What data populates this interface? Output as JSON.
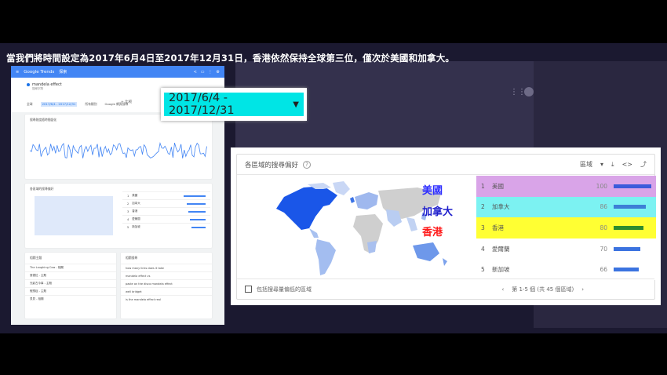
{
  "caption": "當我們將時間設定為2017年6月4日至2017年12月31日，香港依然保持全球第三位，僅次於美國和加拿大。",
  "trends": {
    "logo": "Google Trends",
    "section": "探索",
    "term": "mandela effect",
    "term_sub": "搜尋字詞",
    "add_label": "+ 比較",
    "filters": [
      "全球",
      "2017/6/4 - 2017/12/31",
      "所有類別",
      "Google 網頁搜尋"
    ],
    "card1_title": "搜尋熱度隨時間變化",
    "card2_title": "各區域的搜尋偏好",
    "card2_rows": [
      {
        "rank": "1",
        "name": "美國",
        "pct": 100
      },
      {
        "rank": "2",
        "name": "加拿大",
        "pct": 86
      },
      {
        "rank": "3",
        "name": "香港",
        "pct": 80
      },
      {
        "rank": "4",
        "name": "愛爾蘭",
        "pct": 70
      },
      {
        "rank": "5",
        "name": "新加坡",
        "pct": 66
      }
    ],
    "card3_title": "相關主題",
    "card4_title": "相關搜尋",
    "card3_rows": [
      "The Laughing Cow - 相關",
      "曼德拉 - 主題",
      "光影古今事 - 主題",
      "假想症 - 主題",
      "貝貝 - 相關"
    ],
    "card4_rows": [
      "how many links does it take",
      "mandela effect vs",
      "paste on the disco mandela effect",
      "well bridget",
      "is the mandela effect real"
    ]
  },
  "zoom_date": "2017/6/4 - 2017/12/31",
  "region": {
    "title": "各區域的搜尋偏好",
    "scope_label": "區域",
    "rows": [
      {
        "rank": "1",
        "name": "美國",
        "value": "100",
        "pct": 100,
        "bg": "#d9a4e8",
        "bar": "#3b5bdb",
        "tag": "美國",
        "tag_color": "#2d2dff"
      },
      {
        "rank": "2",
        "name": "加拿大",
        "value": "86",
        "pct": 86,
        "bg": "#7cf2f2",
        "bar": "#3d7fd6",
        "tag": "加拿大",
        "tag_color": "#1e1ecc"
      },
      {
        "rank": "3",
        "name": "香港",
        "value": "80",
        "pct": 80,
        "bg": "#ffff33",
        "bar": "#2e8b2e",
        "tag": "香港",
        "tag_color": "#ff1a1a"
      },
      {
        "rank": "4",
        "name": "愛爾蘭",
        "value": "70",
        "pct": 70,
        "bg": "#ffffff",
        "bar": "#3b73e0",
        "tag": "",
        "tag_color": ""
      },
      {
        "rank": "5",
        "name": "新加坡",
        "value": "66",
        "pct": 66,
        "bg": "#ffffff",
        "bar": "#3b73e0",
        "tag": "",
        "tag_color": ""
      }
    ],
    "checkbox_label": "包括搜尋量偏低的區域",
    "pager_text": "第 1-5 個 (共 45 個區域)"
  }
}
